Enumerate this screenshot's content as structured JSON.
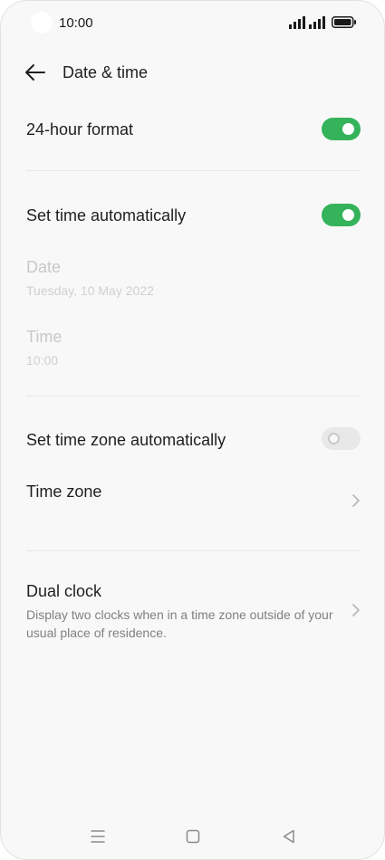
{
  "status_bar": {
    "time": "10:00",
    "icons": [
      "camera-dot",
      "signal-icon",
      "signal-icon",
      "battery-icon"
    ]
  },
  "header": {
    "title": "Date & time",
    "back_icon": "arrow-left-icon"
  },
  "settings": {
    "hour_format": {
      "label": "24-hour format",
      "toggle_on": true
    },
    "set_time_auto": {
      "label": "Set time automatically",
      "toggle_on": true
    },
    "date": {
      "label": "Date",
      "value": "Tuesday, 10 May 2022",
      "enabled": false
    },
    "time": {
      "label": "Time",
      "value": "10:00",
      "enabled": false
    },
    "set_timezone_auto": {
      "label": "Set time zone automatically",
      "toggle_on": false
    },
    "time_zone": {
      "label": "Time zone",
      "icon": "chevron-right-icon"
    },
    "dual_clock": {
      "label": "Dual clock",
      "description": "Display two clocks when in a time zone outside of your usual place of residence.",
      "icon": "chevron-right-icon"
    }
  },
  "nav_bar": {
    "icons": [
      "menu-icon",
      "home-square-icon",
      "back-triangle-icon"
    ]
  },
  "colors": {
    "toggle_on": "#34b35a",
    "toggle_off": "#e8e8e8",
    "background": "#f8f8f8",
    "disabled_text": "#c8c8c8"
  }
}
